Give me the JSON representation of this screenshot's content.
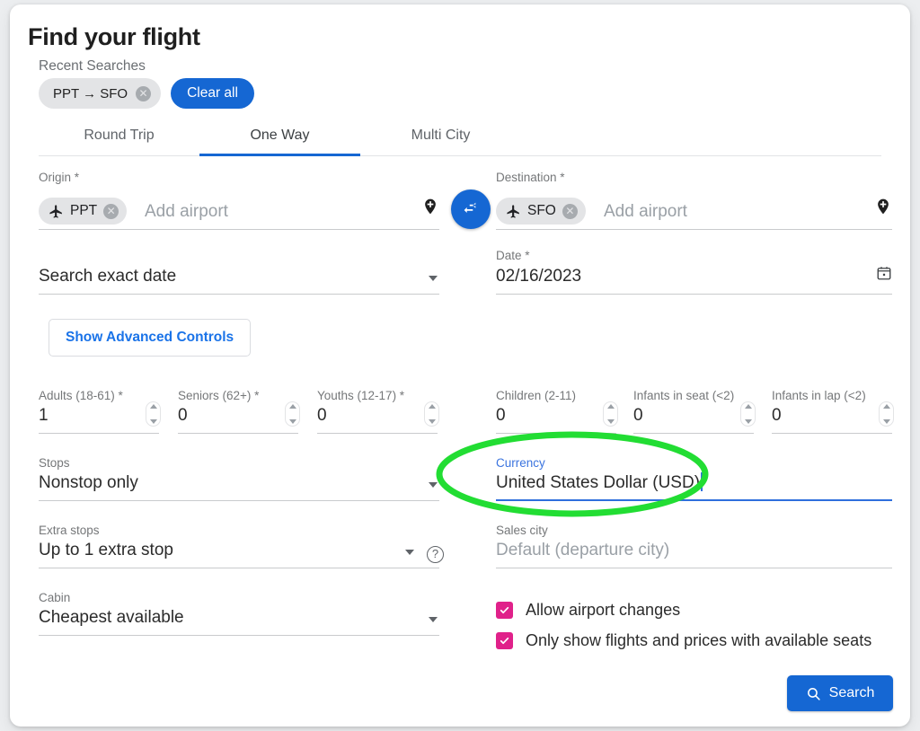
{
  "header": {
    "title": "Find your flight",
    "recent_searches_label": "Recent Searches",
    "recent_chip": "PPT → SFO",
    "clear_all_label": "Clear all"
  },
  "tabs": [
    {
      "label": "Round Trip",
      "active": false
    },
    {
      "label": "One Way",
      "active": true
    },
    {
      "label": "Multi City",
      "active": false
    }
  ],
  "route": {
    "origin_label": "Origin *",
    "origin_chip": "PPT",
    "origin_placeholder": "Add airport",
    "destination_label": "Destination *",
    "destination_chip": "SFO",
    "destination_placeholder": "Add airport",
    "swap_icon": "swap-horizontal-icon"
  },
  "dates": {
    "date_mode_value": "Search exact date",
    "date_label": "Date *",
    "date_value": "02/16/2023",
    "calendar_icon": "calendar-icon"
  },
  "advanced_button_label": "Show Advanced Controls",
  "passengers": [
    {
      "label": "Adults (18-61) *",
      "value": "1"
    },
    {
      "label": "Seniors (62+) *",
      "value": "0"
    },
    {
      "label": "Youths (12-17) *",
      "value": "0"
    },
    {
      "label": "Children (2-11)",
      "value": "0"
    },
    {
      "label": "Infants in seat (<2)",
      "value": "0"
    },
    {
      "label": "Infants in lap (<2)",
      "value": "0"
    }
  ],
  "options": {
    "stops_label": "Stops",
    "stops_value": "Nonstop only",
    "extra_stops_label": "Extra stops",
    "extra_stops_value": "Up to 1 extra stop",
    "extra_stops_help": "?",
    "cabin_label": "Cabin",
    "cabin_value": "Cheapest available",
    "currency_label": "Currency",
    "currency_value": "United States Dollar (USD)",
    "sales_city_label": "Sales city",
    "sales_city_placeholder": "Default (departure city)"
  },
  "checkboxes": [
    {
      "label": "Allow airport changes",
      "checked": true
    },
    {
      "label": "Only show flights and prices with available seats",
      "checked": true
    }
  ],
  "search_button": {
    "label": "Search",
    "icon": "search-icon"
  },
  "annotation": {
    "shape": "ellipse-highlight",
    "color": "#22dd33",
    "targets": "currency-field"
  },
  "colors": {
    "accent_blue": "#1567d3",
    "checkbox_pink": "#e0218a",
    "annotation_green": "#22dd33"
  }
}
